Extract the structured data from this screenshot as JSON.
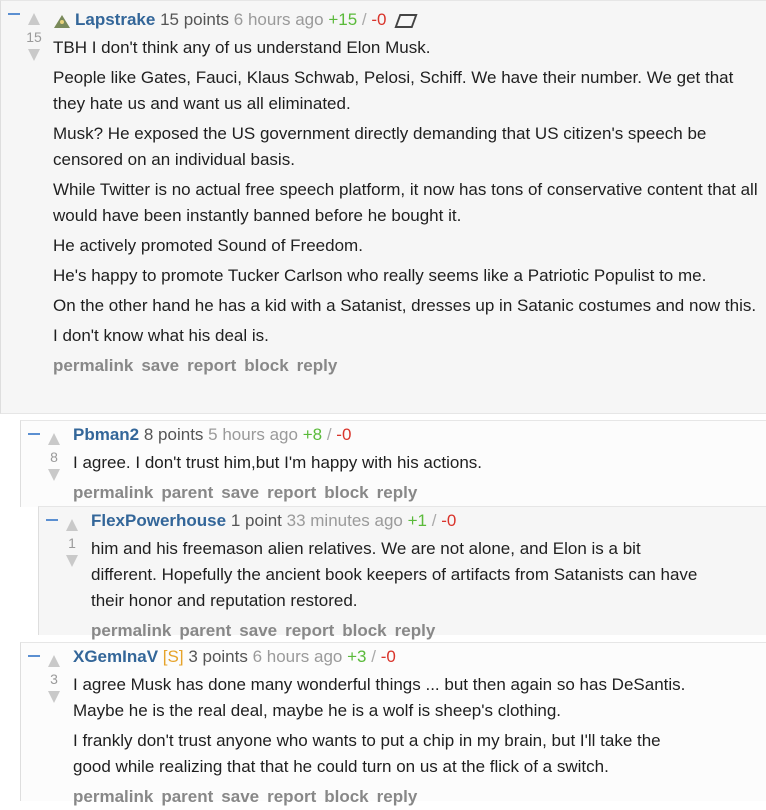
{
  "actions_top": [
    "permalink",
    "save",
    "report",
    "block",
    "reply"
  ],
  "actions_child": [
    "permalink",
    "parent",
    "save",
    "report",
    "block",
    "reply"
  ],
  "c1": {
    "author": "Lapstrake",
    "points": "15 points",
    "time": "6 hours ago",
    "up": "+15",
    "sep": "/",
    "down": "-0",
    "score": "15",
    "paragraphs": [
      "TBH I don't think any of us understand Elon Musk.",
      "People like Gates, Fauci, Klaus Schwab, Pelosi, Schiff. We have their number. We get that they hate us and want us all eliminated.",
      "Musk? He exposed the US government directly demanding that US citizen's speech be censored on an individual basis.",
      "While Twitter is no actual free speech platform, it now has tons of conservative content that all would have been instantly banned before he bought it.",
      "He actively promoted Sound of Freedom.",
      "He's happy to promote Tucker Carlson who really seems like a Patriotic Populist to me.",
      "On the other hand he has a kid with a Satanist, dresses up in Satanic costumes and now this.",
      "I don't know what his deal is."
    ]
  },
  "c2": {
    "author": "Pbman2",
    "points": "8 points",
    "time": "5 hours ago",
    "up": "+8",
    "sep": "/",
    "down": "-0",
    "score": "8",
    "paragraphs": [
      "I agree. I don't trust him,but I'm happy with his actions."
    ]
  },
  "c3": {
    "author": "FlexPowerhouse",
    "points": "1 point",
    "time": "33 minutes ago",
    "up": "+1",
    "sep": "/",
    "down": "-0",
    "score": "1",
    "paragraphs": [
      "him and his freemason alien relatives. We are not alone, and Elon is a bit different. Hopefully the ancient book keepers of artifacts from Satanists can have their honor and reputation restored."
    ]
  },
  "c4": {
    "author": "XGemInaV",
    "badge": "[S]",
    "points": "3 points",
    "time": "6 hours ago",
    "up": "+3",
    "sep": "/",
    "down": "-0",
    "score": "3",
    "paragraphs": [
      "I agree Musk has done many wonderful things ... but then again so has DeSantis. Maybe he is the real deal, maybe he is a wolf is sheep's clothing.",
      "I frankly don't trust anyone who wants to put a chip in my brain, but I'll take the good while realizing that that he could turn on us at the flick of a switch."
    ]
  }
}
